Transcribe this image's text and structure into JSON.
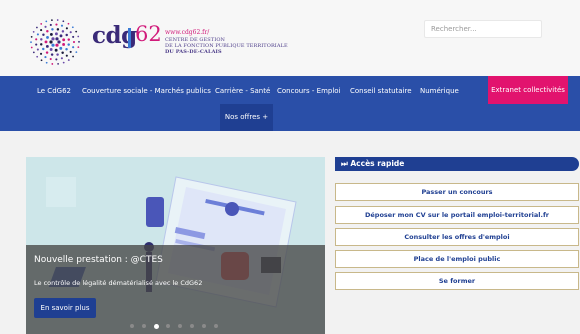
{
  "header": {
    "site_url": "www.cdg62.fr/",
    "org_line1": "CENTRE DE GESTION",
    "org_line2": "DE LA FONCTION PUBLIQUE TERRITORIALE",
    "org_line3": "DU PAS-DE-CALAIS",
    "logo_cdg": "cdg",
    "logo_62": "62",
    "search_placeholder": "Rechercher..."
  },
  "nav": {
    "items": [
      "Le CdG62",
      "Couverture sociale - Marchés publics",
      "Carrière - Santé",
      "Concours - Emploi",
      "Conseil statutaire",
      "Numérique"
    ],
    "extranet": "Extranet collectivités",
    "offres": "Nos offres +"
  },
  "hero": {
    "title": "Nouvelle prestation : @CTES",
    "subtitle": "Le contrôle de légalité dématérialisé avec le CdG62",
    "button": "En savoir plus",
    "slide_count": 8,
    "active_slide": 3
  },
  "quick_access": {
    "title": "Accès rapide",
    "links": [
      "Passer un concours",
      "Déposer mon CV sur le portail emploi-territorial.fr",
      "Consulter les offres d'emploi",
      "Place de l'emploi public",
      "Se former"
    ]
  },
  "colors": {
    "nav_blue": "#2a4fa8",
    "dark_blue": "#1f3f92",
    "pink": "#e2136e"
  }
}
